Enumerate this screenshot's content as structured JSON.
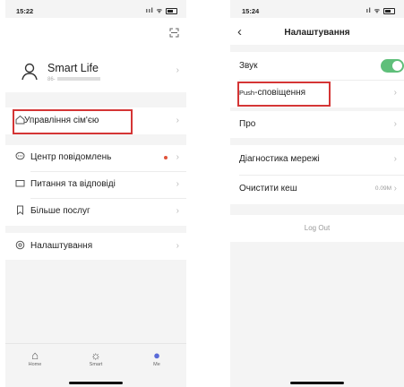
{
  "left": {
    "status_time": "15:22",
    "status_icons": "ııl ᯤ",
    "scan_icon": "scan-icon",
    "profile": {
      "name": "Smart Life",
      "sub": "86-"
    },
    "family": {
      "label": "Управління сім'єю"
    },
    "menu": [
      {
        "label": "Центр повідомлень",
        "icon": "chat-icon",
        "badge": true
      },
      {
        "label": "Питання та відповіді",
        "icon": "mail-icon"
      },
      {
        "label": "Більше послуг",
        "icon": "bookmark-icon"
      }
    ],
    "settings": {
      "label": "Налаштування"
    },
    "tabs": [
      {
        "label": "Home",
        "icon": "home-icon"
      },
      {
        "label": "Smart",
        "icon": "sun-icon"
      },
      {
        "label": "Me",
        "icon": "profile-icon"
      }
    ]
  },
  "right": {
    "status_time": "15:24",
    "status_icons": "ıl ᯤ",
    "title": "Налаштування",
    "back": "‹",
    "items": [
      {
        "label": "Звук",
        "toggle": true
      },
      {
        "label_small": "Push",
        "label": "-сповіщення"
      },
      {
        "label": "Про"
      },
      {
        "label": "Діагностика мережі"
      },
      {
        "label": "Очистити кеш",
        "value": "0.09M"
      }
    ],
    "logout": "Log Out"
  },
  "colors": {
    "highlight": "#d43535",
    "toggle_on": "#5fbf7a",
    "accent": "#5a6bd8",
    "badge": "#e0533b"
  }
}
